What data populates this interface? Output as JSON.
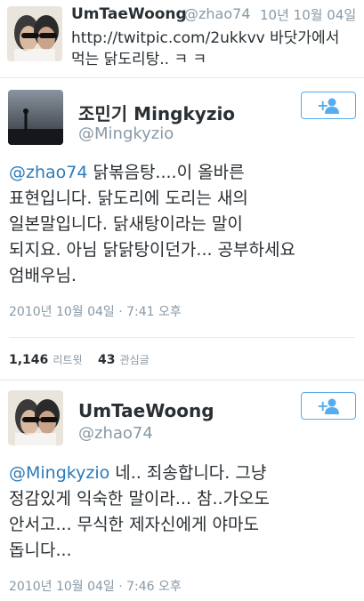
{
  "top_tweet": {
    "name": "UmTaeWoong",
    "handle": "@zhao74",
    "time": "10년 10월 04일",
    "text_line1": "http://twitpic.com/2ukkvv 바닷가에서",
    "text_line2": "먹는 닭도리탕.. ㅋ ㅋ"
  },
  "main_tweet": {
    "name": "조민기 Mingkyzio",
    "handle": "@Mingkyzio",
    "mention": "@zhao74",
    "text_line1": " 닭볶음탕....이 올바른",
    "text_line2": "표현입니다. 닭도리에 도리는 새의",
    "text_line3": "일본말입니다. 닭새탕이라는 말이",
    "text_line4": "되지요. 아님 닭닭탕이던가... 공부하세요",
    "text_line5": "엄배우님.",
    "timestamp": "2010년 10월 04일 · 7:41 오후",
    "retweets_count": "1,146",
    "retweets_label": "리트윗",
    "favorites_count": "43",
    "favorites_label": "관심글"
  },
  "reply_tweet": {
    "name": "UmTaeWoong",
    "handle": "@zhao74",
    "mention": "@Mingkyzio",
    "text_line1": " 네.. 죄송합니다.  그냥",
    "text_line2": "정감있게 익숙한 말이라... 참..가오도",
    "text_line3": "안서고... 무식한 제자신에게 야마도",
    "text_line4": "돕니다...",
    "timestamp": "2010년 10월 04일 · 7:46 오후"
  },
  "icons": {
    "follow": "add-user-icon"
  },
  "colors": {
    "accent": "#55acee",
    "mention": "#2b7bb9",
    "muted": "#8899a6"
  }
}
